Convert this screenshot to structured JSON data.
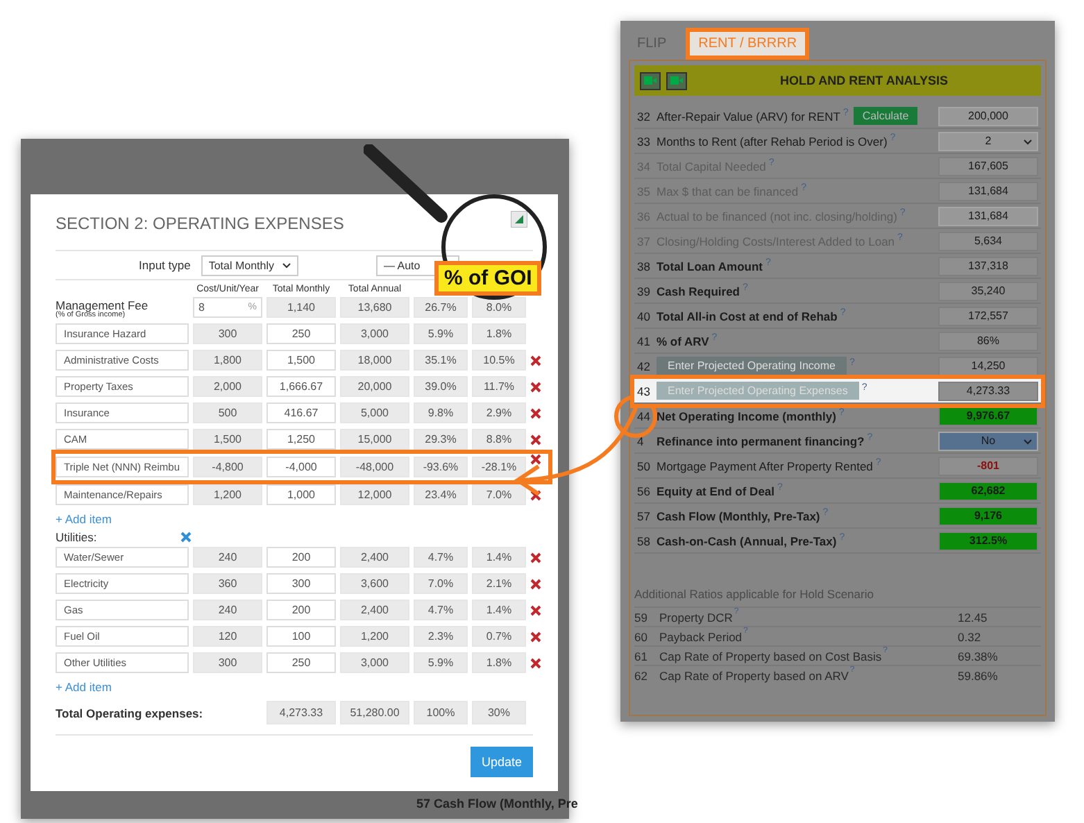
{
  "backdrop": {
    "text": "57  Cash Flow (Monthly, Pre"
  },
  "modal": {
    "title": "SECTION 2: OPERATING EXPENSES",
    "input_type_label": "Input type",
    "input_type": "Total Monthly",
    "autofill": "— Auto",
    "columns": [
      "Cost/Unit/Year",
      "Total Monthly",
      "Total Annual"
    ],
    "management_fee": {
      "label": "Management Fee",
      "note": "(% of Gross income)",
      "cost": "8",
      "unit": "%",
      "monthly": "1,140",
      "annual": "13,680",
      "pct_expenses": "26.7%",
      "pct_income": "8.0%"
    },
    "items": [
      {
        "name": "Insurance Hazard",
        "cost": "300",
        "monthly": "250",
        "annual": "3,000",
        "pct_expenses": "5.9%",
        "pct_income": "1.8%",
        "deletable": false,
        "highlighted": false
      },
      {
        "name": "Administrative Costs",
        "cost": "1,800",
        "monthly": "1,500",
        "annual": "18,000",
        "pct_expenses": "35.1%",
        "pct_income": "10.5%",
        "deletable": true,
        "highlighted": false
      },
      {
        "name": "Property Taxes",
        "cost": "2,000",
        "monthly": "1,666.67",
        "annual": "20,000",
        "pct_expenses": "39.0%",
        "pct_income": "11.7%",
        "deletable": true,
        "highlighted": false
      },
      {
        "name": "Insurance",
        "cost": "500",
        "monthly": "416.67",
        "annual": "5,000",
        "pct_expenses": "9.8%",
        "pct_income": "2.9%",
        "deletable": true,
        "highlighted": false
      },
      {
        "name": "CAM",
        "cost": "1,500",
        "monthly": "1,250",
        "annual": "15,000",
        "pct_expenses": "29.3%",
        "pct_income": "8.8%",
        "deletable": true,
        "highlighted": false
      },
      {
        "name": "Triple Net (NNN) Reimbu",
        "cost": "-4,800",
        "monthly": "-4,000",
        "annual": "-48,000",
        "pct_expenses": "-93.6%",
        "pct_income": "-28.1%",
        "deletable": true,
        "highlighted": true
      },
      {
        "name": "Maintenance/Repairs",
        "cost": "1,200",
        "monthly": "1,000",
        "annual": "12,000",
        "pct_expenses": "23.4%",
        "pct_income": "7.0%",
        "deletable": true,
        "highlighted": false
      }
    ],
    "add_item": "+ Add item",
    "utilities_label": "Utilities:",
    "utilities": [
      {
        "name": "Water/Sewer",
        "cost": "240",
        "monthly": "200",
        "annual": "2,400",
        "pct_expenses": "4.7%",
        "pct_income": "1.4%",
        "deletable": true,
        "highlighted": false
      },
      {
        "name": "Electricity",
        "cost": "360",
        "monthly": "300",
        "annual": "3,600",
        "pct_expenses": "7.0%",
        "pct_income": "2.1%",
        "deletable": true,
        "highlighted": false
      },
      {
        "name": "Gas",
        "cost": "240",
        "monthly": "200",
        "annual": "2,400",
        "pct_expenses": "4.7%",
        "pct_income": "1.4%",
        "deletable": true,
        "highlighted": false
      },
      {
        "name": "Fuel Oil",
        "cost": "120",
        "monthly": "100",
        "annual": "1,200",
        "pct_expenses": "2.3%",
        "pct_income": "0.7%",
        "deletable": true,
        "highlighted": false
      },
      {
        "name": "Other Utilities",
        "cost": "300",
        "monthly": "250",
        "annual": "3,000",
        "pct_expenses": "5.9%",
        "pct_income": "1.8%",
        "deletable": true,
        "highlighted": false
      }
    ],
    "add_utility": "+ Add item",
    "total_label": "Total Operating expenses:",
    "totals": [
      "4,273.33",
      "51,280.00",
      "100%",
      "30%"
    ],
    "update": "Update"
  },
  "magnifier": {
    "label": "% of GOI"
  },
  "analysis": {
    "tabs": [
      {
        "label": "FLIP",
        "selected": false
      },
      {
        "label": "RENT / BRRRR",
        "selected": true
      }
    ],
    "header": "HOLD AND RENT ANALYSIS",
    "rows": [
      {
        "num": "32",
        "kind": "plain",
        "label": "After-Repair Value (ARV) for RENT",
        "help": "?",
        "action": "Calculate",
        "value": "200,000",
        "editable": true,
        "dropdown": false,
        "negative": false,
        "color": "#989898",
        "highlighted": false
      },
      {
        "num": "33",
        "kind": "plain",
        "label": "Months to Rent (after Rehab Period is Over)",
        "help": "?",
        "value": "2",
        "editable": true,
        "dropdown": true,
        "negative": false,
        "color": "#989898",
        "highlighted": false
      },
      {
        "num": "34",
        "kind": "muted",
        "label": "Total Capital Needed",
        "help": "?",
        "value": "167,605",
        "editable": false,
        "dropdown": false,
        "negative": false,
        "color": "#8f8f8f",
        "highlighted": false
      },
      {
        "num": "35",
        "kind": "muted",
        "label": "Max $ that can be financed",
        "help": "?",
        "value": "131,684",
        "editable": false,
        "dropdown": false,
        "negative": false,
        "color": "#8f8f8f",
        "highlighted": false
      },
      {
        "num": "36",
        "kind": "muted",
        "label": "Actual to be financed (not inc. closing/holding)",
        "help": "?",
        "value": "131,684",
        "editable": true,
        "dropdown": false,
        "negative": false,
        "color": "#989898",
        "highlighted": false
      },
      {
        "num": "37",
        "kind": "muted",
        "label": "Closing/Holding Costs/Interest Added to Loan",
        "help": "?",
        "value": "5,634",
        "editable": false,
        "dropdown": false,
        "negative": false,
        "color": "#8f8f8f",
        "highlighted": false
      },
      {
        "num": "38",
        "kind": "bold",
        "label": "Total Loan Amount",
        "help": "?",
        "value": "137,318",
        "editable": false,
        "dropdown": false,
        "negative": false,
        "color": "#8f8f8f",
        "highlighted": false
      },
      {
        "num": "39",
        "kind": "bold",
        "label": "Cash Required",
        "help": "?",
        "value": "35,240",
        "editable": false,
        "dropdown": false,
        "negative": false,
        "color": "#8f8f8f",
        "highlighted": false
      },
      {
        "num": "40",
        "kind": "bold",
        "label": "Total All-in Cost at end of Rehab",
        "help": "?",
        "value": "172,557",
        "editable": false,
        "dropdown": false,
        "negative": false,
        "color": "#8f8f8f",
        "highlighted": false
      },
      {
        "num": "41",
        "kind": "bold",
        "label": "% of ARV",
        "help": "?",
        "value": "86%",
        "editable": false,
        "dropdown": false,
        "negative": false,
        "color": "#8f8f8f",
        "highlighted": false
      },
      {
        "num": "42",
        "kind": "button",
        "label": "Enter Projected Operating Income",
        "help": "?",
        "value": "14,250",
        "editable": false,
        "dropdown": false,
        "negative": false,
        "color": "#8f8f8f",
        "highlighted": false
      },
      {
        "num": "43",
        "kind": "button",
        "label": "Enter Projected Operating Expenses",
        "help": "?",
        "value": "4,273.33",
        "editable": false,
        "dropdown": false,
        "negative": false,
        "color": "#8f8f8f",
        "highlighted": true
      },
      {
        "num": "44",
        "kind": "bold",
        "label": "Net Operating Income (monthly)",
        "help": "?",
        "value": "9,976.67",
        "editable": false,
        "dropdown": false,
        "negative": false,
        "color": "#0b8c0b",
        "highlighted": false
      },
      {
        "num": "4",
        "kind": "bold",
        "label": "Refinance into permanent financing?",
        "help": "?",
        "value": "No",
        "editable": true,
        "dropdown": true,
        "negative": false,
        "color": "#56708f",
        "highlighted": false
      },
      {
        "num": "50",
        "kind": "plain",
        "label": "Mortgage Payment After Property Rented",
        "help": "?",
        "value": "-801",
        "editable": false,
        "dropdown": false,
        "negative": true,
        "color": "#8f8f8f",
        "highlighted": false
      },
      {
        "num": "56",
        "kind": "bold",
        "label": "Equity at End of Deal",
        "help": "?",
        "value": "62,682",
        "editable": false,
        "dropdown": false,
        "negative": false,
        "color": "#0b8c0b",
        "highlighted": false
      },
      {
        "num": "57",
        "kind": "bold",
        "label": "Cash Flow (Monthly, Pre-Tax)",
        "help": "?",
        "value": "9,176",
        "editable": false,
        "dropdown": false,
        "negative": false,
        "color": "#0b8c0b",
        "highlighted": false
      },
      {
        "num": "58",
        "kind": "bold",
        "label": "Cash-on-Cash (Annual, Pre-Tax)",
        "help": "?",
        "value": "312.5%",
        "editable": false,
        "dropdown": false,
        "negative": false,
        "color": "#0b8c0b",
        "highlighted": false
      }
    ],
    "ratios_title": "Additional Ratios applicable for Hold Scenario",
    "ratios": [
      {
        "num": "59",
        "label": "Property DCR",
        "help": "?",
        "value": "12.45"
      },
      {
        "num": "60",
        "label": "Payback Period",
        "help": "?",
        "value": "0.32"
      },
      {
        "num": "61",
        "label": "Cap Rate of Property based on Cost Basis",
        "help": "?",
        "value": "69.38%"
      },
      {
        "num": "62",
        "label": "Cap Rate of Property based on ARV",
        "help": "?",
        "value": "59.86%"
      }
    ]
  }
}
